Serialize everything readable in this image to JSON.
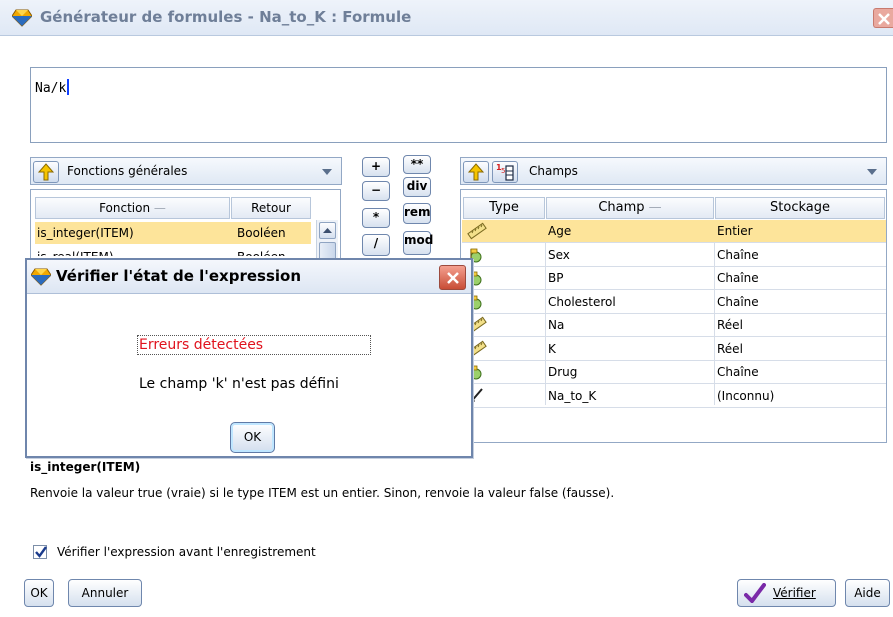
{
  "window": {
    "title": "Générateur de formules - Na_to_K : Formule"
  },
  "expression": {
    "text": "Na/k"
  },
  "functions": {
    "category": "Fonctions générales",
    "columns": [
      "Fonction",
      "Retour"
    ],
    "rows": [
      {
        "name": "is_integer(ITEM)",
        "ret": "Booléen"
      },
      {
        "name": "is_real(ITEM)",
        "ret": "Booléen"
      }
    ]
  },
  "operators": [
    {
      "label": "+",
      "name": "plus"
    },
    {
      "label": "**",
      "name": "power"
    },
    {
      "label": "−",
      "name": "minus"
    },
    {
      "label": "div",
      "name": "div"
    },
    {
      "label": "*",
      "name": "multiply"
    },
    {
      "label": "rem",
      "name": "rem"
    },
    {
      "label": "/",
      "name": "divide"
    },
    {
      "label": "mod",
      "name": "mod"
    }
  ],
  "fields": {
    "category": "Champs",
    "columns": [
      "Type",
      "Champ",
      "Stockage"
    ],
    "rows": [
      {
        "name": "Age",
        "storage": "Entier",
        "type_icon": "continuous-ruler-icon"
      },
      {
        "name": "Sex",
        "storage": "Chaîne",
        "type_icon": "flag-icon"
      },
      {
        "name": "BP",
        "storage": "Chaîne",
        "type_icon": "flag-icon"
      },
      {
        "name": "Cholesterol",
        "storage": "Chaîne",
        "type_icon": "flag-icon"
      },
      {
        "name": "Na",
        "storage": "Réel",
        "type_icon": "continuous-ruler-icon"
      },
      {
        "name": "K",
        "storage": "Réel",
        "type_icon": "continuous-ruler-icon"
      },
      {
        "name": "Drug",
        "storage": "Chaîne",
        "type_icon": "flag-icon"
      },
      {
        "name": "Na_to_K",
        "storage": "(Inconnu)",
        "type_icon": "unknown-icon"
      }
    ]
  },
  "description": {
    "title": "is_integer(ITEM)",
    "text": "Renvoie la valeur true (vraie) si le type ITEM est un entier. Sinon, renvoie la valeur false (fausse)."
  },
  "check_before_save": {
    "label": "Vérifier l'expression avant l'enregistrement",
    "checked": true
  },
  "buttons": {
    "ok": "OK",
    "cancel": "Annuler",
    "check": "Vérifier",
    "help": "Aide"
  },
  "dialog": {
    "title": "Vérifier l'état de l'expression",
    "error": "Erreurs détectées",
    "message": "Le champ 'k' n'est pas défini",
    "ok": "OK"
  },
  "colors": {
    "selection": "#fde49a",
    "error_text": "#e0121d",
    "border": "#93a8c5"
  }
}
